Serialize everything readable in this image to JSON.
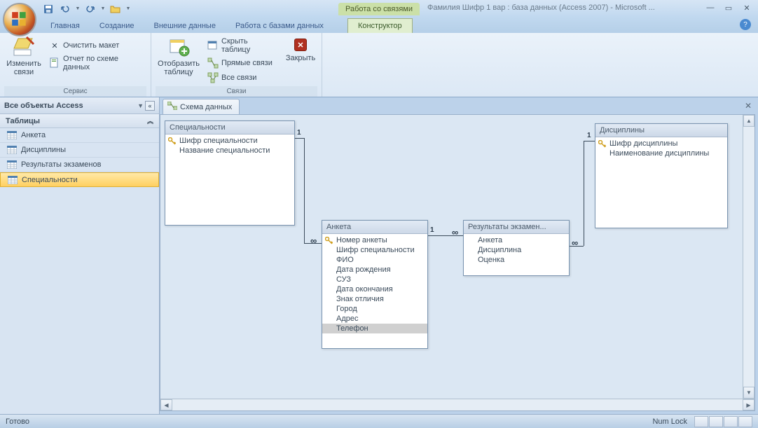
{
  "titlebar": {
    "context_title": "Работа со связями",
    "app_title": "Фамилия Шифр 1 вар : база данных (Access 2007) - Microsoft ..."
  },
  "tabs": {
    "home": "Главная",
    "create": "Создание",
    "external": "Внешние данные",
    "dbtools": "Работа с базами данных",
    "design": "Конструктор"
  },
  "ribbon": {
    "group1_label": "Сервис",
    "edit_rel": "Изменить связи",
    "clear_layout": "Очистить макет",
    "rel_report": "Отчет по схеме данных",
    "group2_label": "Связи",
    "show_table": "Отобразить таблицу",
    "hide_table": "Скрыть таблицу",
    "direct_rel": "Прямые связи",
    "all_rel": "Все связи",
    "close": "Закрыть"
  },
  "navpane": {
    "header": "Все объекты Access",
    "group": "Таблицы",
    "items": [
      "Анкета",
      "Дисциплины",
      "Результаты экзаменов",
      "Специальности"
    ],
    "selected_index": 3
  },
  "doc": {
    "tab_title": "Схема данных"
  },
  "tables": {
    "t1": {
      "title": "Специальности",
      "fields": [
        "Шифр специальности",
        "Название специальности"
      ],
      "pk": [
        0
      ]
    },
    "t2": {
      "title": "Анкета",
      "fields": [
        "Номер анкеты",
        "Шифр специальности",
        "ФИО",
        "Дата рождения",
        "СУЗ",
        "Дата окончания",
        "Знак отличия",
        "Город",
        "Адрес",
        "Телефон"
      ],
      "pk": [
        0
      ],
      "selected": 9
    },
    "t3": {
      "title": "Результаты экзамен...",
      "fields": [
        "Анкета",
        "Дисциплина",
        "Оценка"
      ],
      "pk": []
    },
    "t4": {
      "title": "Дисциплины",
      "fields": [
        "Шифр дисциплины",
        "Наименование дисциплины"
      ],
      "pk": [
        0
      ]
    }
  },
  "rel_labels": {
    "one": "1",
    "many": "∞"
  },
  "statusbar": {
    "left": "Готово",
    "numlock": "Num Lock"
  }
}
